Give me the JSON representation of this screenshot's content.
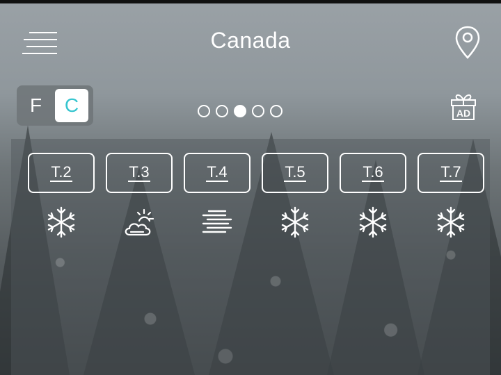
{
  "header": {
    "title": "Canada",
    "menu_icon": "hamburger-menu-icon",
    "location_icon": "location-pin-icon"
  },
  "units": {
    "fahrenheit_label": "F",
    "celsius_label": "C",
    "selected": "C",
    "accent_color": "#36c5cf"
  },
  "pagination": {
    "total": 5,
    "active_index": 3
  },
  "ad": {
    "label": "AD",
    "icon": "gift-ad-icon"
  },
  "forecast": {
    "days": [
      {
        "label": "T.2",
        "icon": "snowflake-icon"
      },
      {
        "label": "T.3",
        "icon": "partly-sunny-cloud-icon"
      },
      {
        "label": "T.4",
        "icon": "fog-icon"
      },
      {
        "label": "T.5",
        "icon": "snowflake-icon"
      },
      {
        "label": "T.6",
        "icon": "snowflake-icon"
      },
      {
        "label": "T.7",
        "icon": "snowflake-icon"
      }
    ]
  }
}
